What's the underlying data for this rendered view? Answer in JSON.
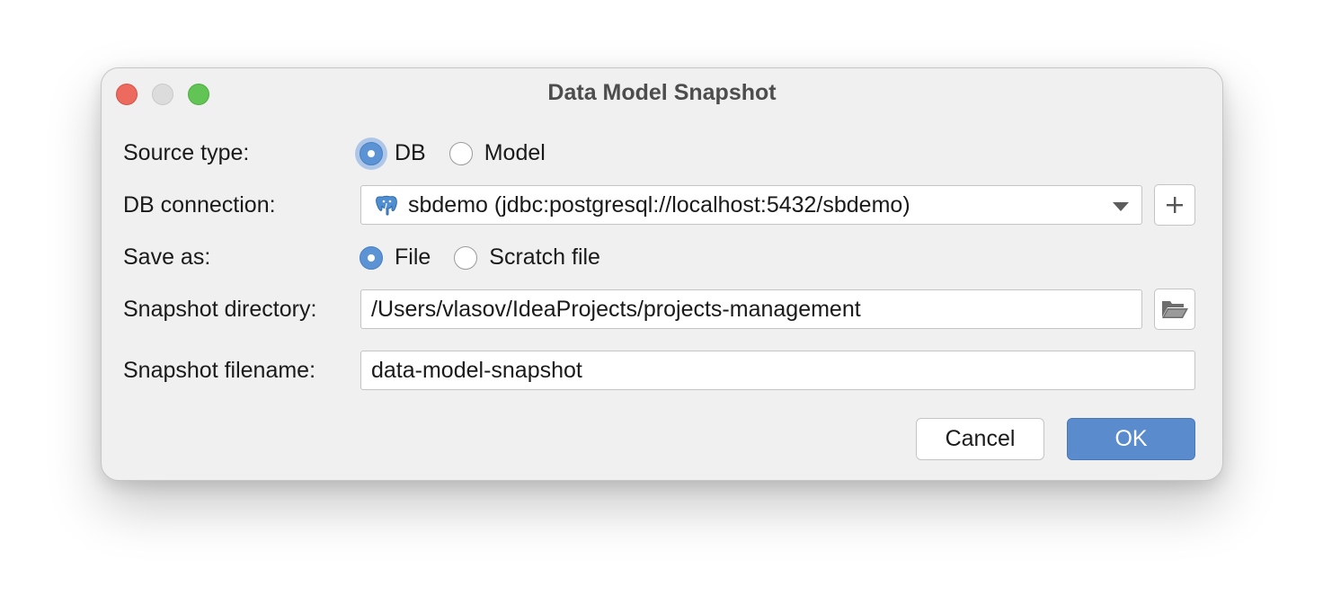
{
  "window": {
    "title": "Data Model Snapshot",
    "controls": [
      "close",
      "minimize",
      "zoom"
    ]
  },
  "form": {
    "source_type": {
      "label": "Source type:",
      "options": [
        {
          "label": "DB",
          "selected": true
        },
        {
          "label": "Model",
          "selected": false
        }
      ]
    },
    "db_connection": {
      "label": "DB connection:",
      "value": "sbdemo (jdbc:postgresql://localhost:5432/sbdemo)",
      "icon": "postgresql-elephant-icon",
      "add_button_icon": "plus-icon"
    },
    "save_as": {
      "label": "Save as:",
      "options": [
        {
          "label": "File",
          "selected": true
        },
        {
          "label": "Scratch file",
          "selected": false
        }
      ]
    },
    "snapshot_directory": {
      "label": "Snapshot directory:",
      "value": "/Users/vlasov/IdeaProjects/projects-management",
      "browse_icon": "folder-icon"
    },
    "snapshot_filename": {
      "label": "Snapshot filename:",
      "value": "data-model-snapshot"
    }
  },
  "buttons": {
    "cancel": "Cancel",
    "ok": "OK"
  },
  "colors": {
    "accent": "#5a8ccd",
    "dialog_background": "#f0f0f0",
    "close": "#ed6a5e",
    "zoom": "#61c454",
    "postgres_icon": "#4f8fd1"
  }
}
